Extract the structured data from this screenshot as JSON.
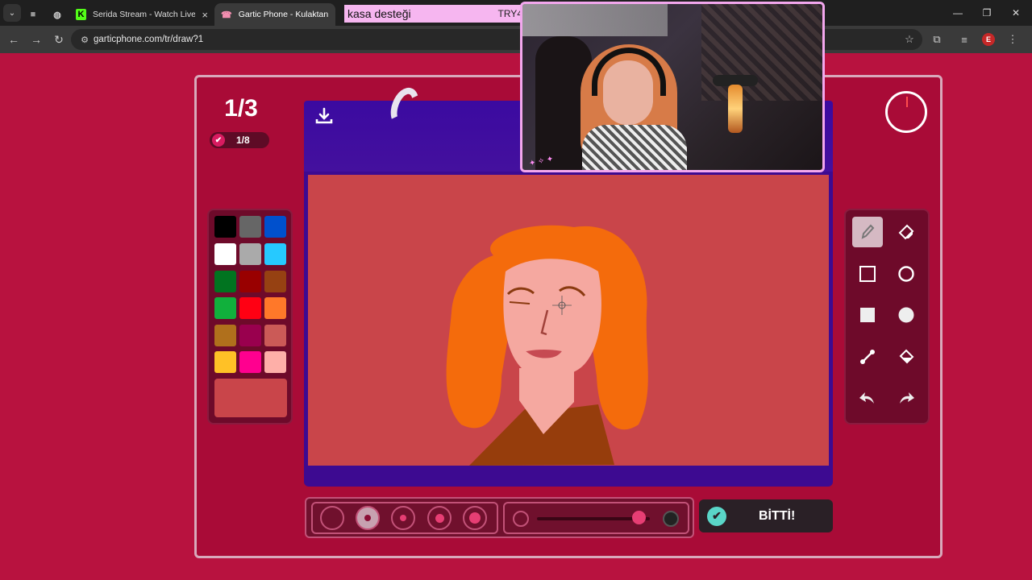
{
  "browser": {
    "tabs": [
      {
        "title": "",
        "icon": "square-icon"
      },
      {
        "title": "",
        "icon": "globe-icon"
      },
      {
        "title": "Serida Stream - Watch Live on",
        "icon": "kick-icon",
        "close": "×"
      },
      {
        "title": "Gartic Phone - Kulaktan Kulağ",
        "icon": "gartic-icon",
        "active": true
      }
    ],
    "url": "garticphone.com/tr/draw?1",
    "profile_initial": "E"
  },
  "stream_overlay": {
    "text": "kasa desteği",
    "side_text": "TRY4"
  },
  "game": {
    "round": "1/3",
    "players_done": "1/8",
    "done_button": "BİTTİ!",
    "current_color": "#c9454a",
    "palette": [
      "#000000",
      "#666666",
      "#0050cd",
      "#ffffff",
      "#aaaaaa",
      "#26c9ff",
      "#017420",
      "#990000",
      "#964112",
      "#11b03c",
      "#ff0013",
      "#ff7829",
      "#b0701c",
      "#99004e",
      "#cb5a57",
      "#ffc126",
      "#ff008f",
      "#feafa8"
    ],
    "tools": [
      {
        "name": "pencil",
        "selected": true
      },
      {
        "name": "eraser"
      },
      {
        "name": "rectangle-outline"
      },
      {
        "name": "ellipse-outline"
      },
      {
        "name": "rectangle-filled"
      },
      {
        "name": "ellipse-filled"
      },
      {
        "name": "line"
      },
      {
        "name": "fill-bucket"
      },
      {
        "name": "undo"
      },
      {
        "name": "redo"
      }
    ],
    "brush_sizes": [
      {
        "selected": false
      },
      {
        "selected": true
      },
      {
        "selected": false
      },
      {
        "selected": false
      },
      {
        "selected": false
      }
    ],
    "opacity": 0.9
  }
}
